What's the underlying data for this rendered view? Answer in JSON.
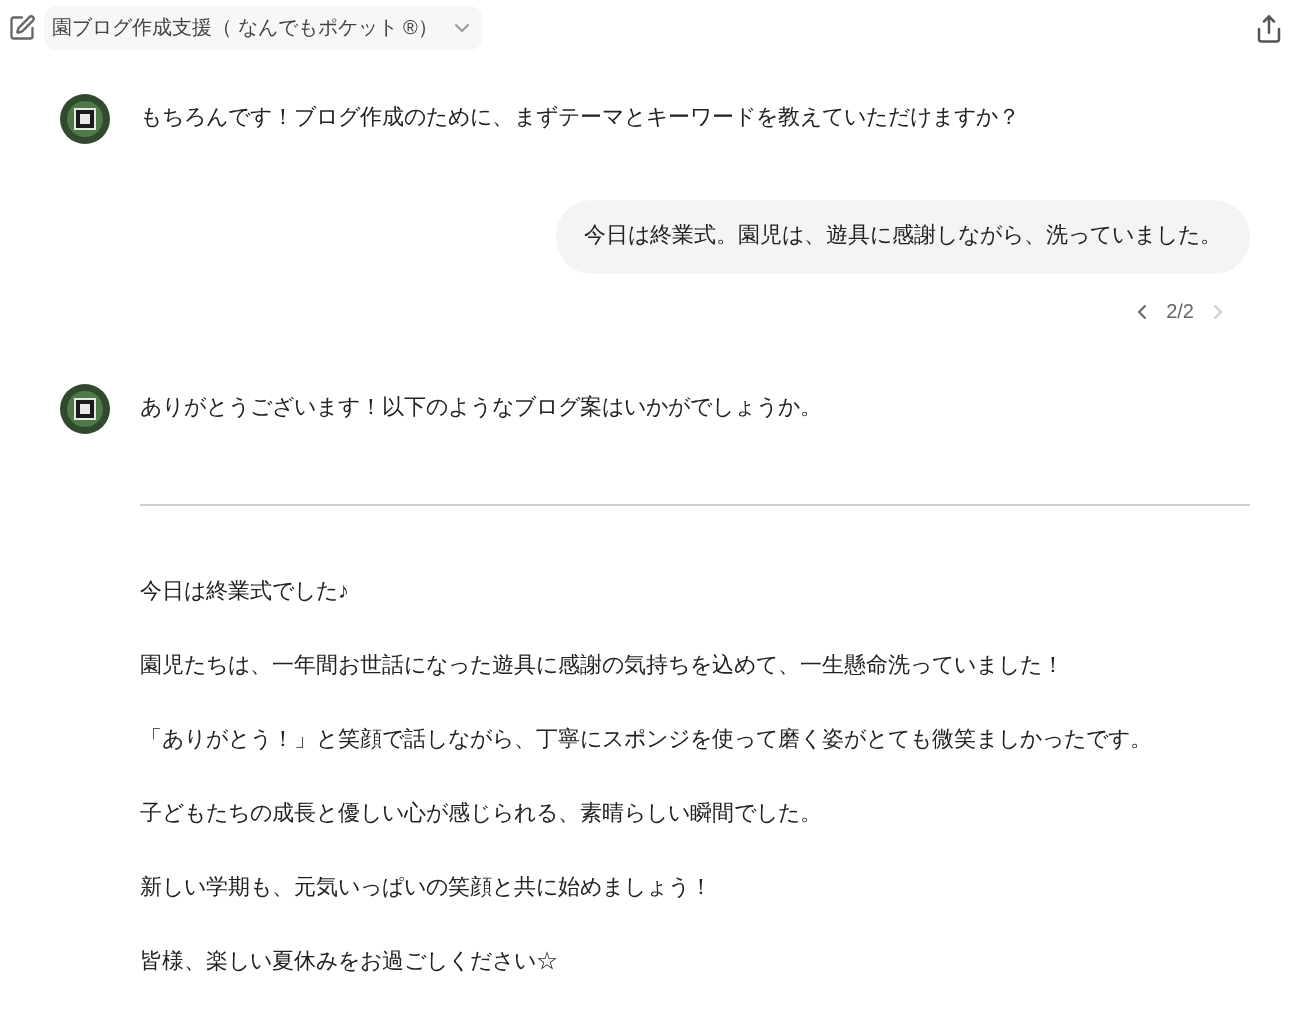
{
  "header": {
    "title": "園ブログ作成支援（ なんでもポケット ®）"
  },
  "messages": [
    {
      "kind": "assistant",
      "text": "もちろんです！ブログ作成のために、まずテーマとキーワードを教えていただけますか？"
    },
    {
      "kind": "user",
      "text": "今日は終業式。園児は、遊具に感謝しながら、洗っていました。",
      "pager": {
        "label": "2/2",
        "prev_disabled": false,
        "next_disabled": true
      }
    },
    {
      "kind": "assistant",
      "text": "ありがとうございます！以下のようなブログ案はいかがでしょうか。",
      "paragraphs": [
        "今日は終業式でした♪",
        "園児たちは、一年間お世話になった遊具に感謝の気持ちを込めて、一生懸命洗っていました！",
        "「ありがとう！」と笑顔で話しながら、丁寧にスポンジを使って磨く姿がとても微笑ましかったです。",
        "子どもたちの成長と優しい心が感じられる、素晴らしい瞬間でした。",
        "新しい学期も、元気いっぱいの笑顔と共に始めましょう！",
        "皆様、楽しい夏休みをお過ごしください☆"
      ]
    }
  ]
}
